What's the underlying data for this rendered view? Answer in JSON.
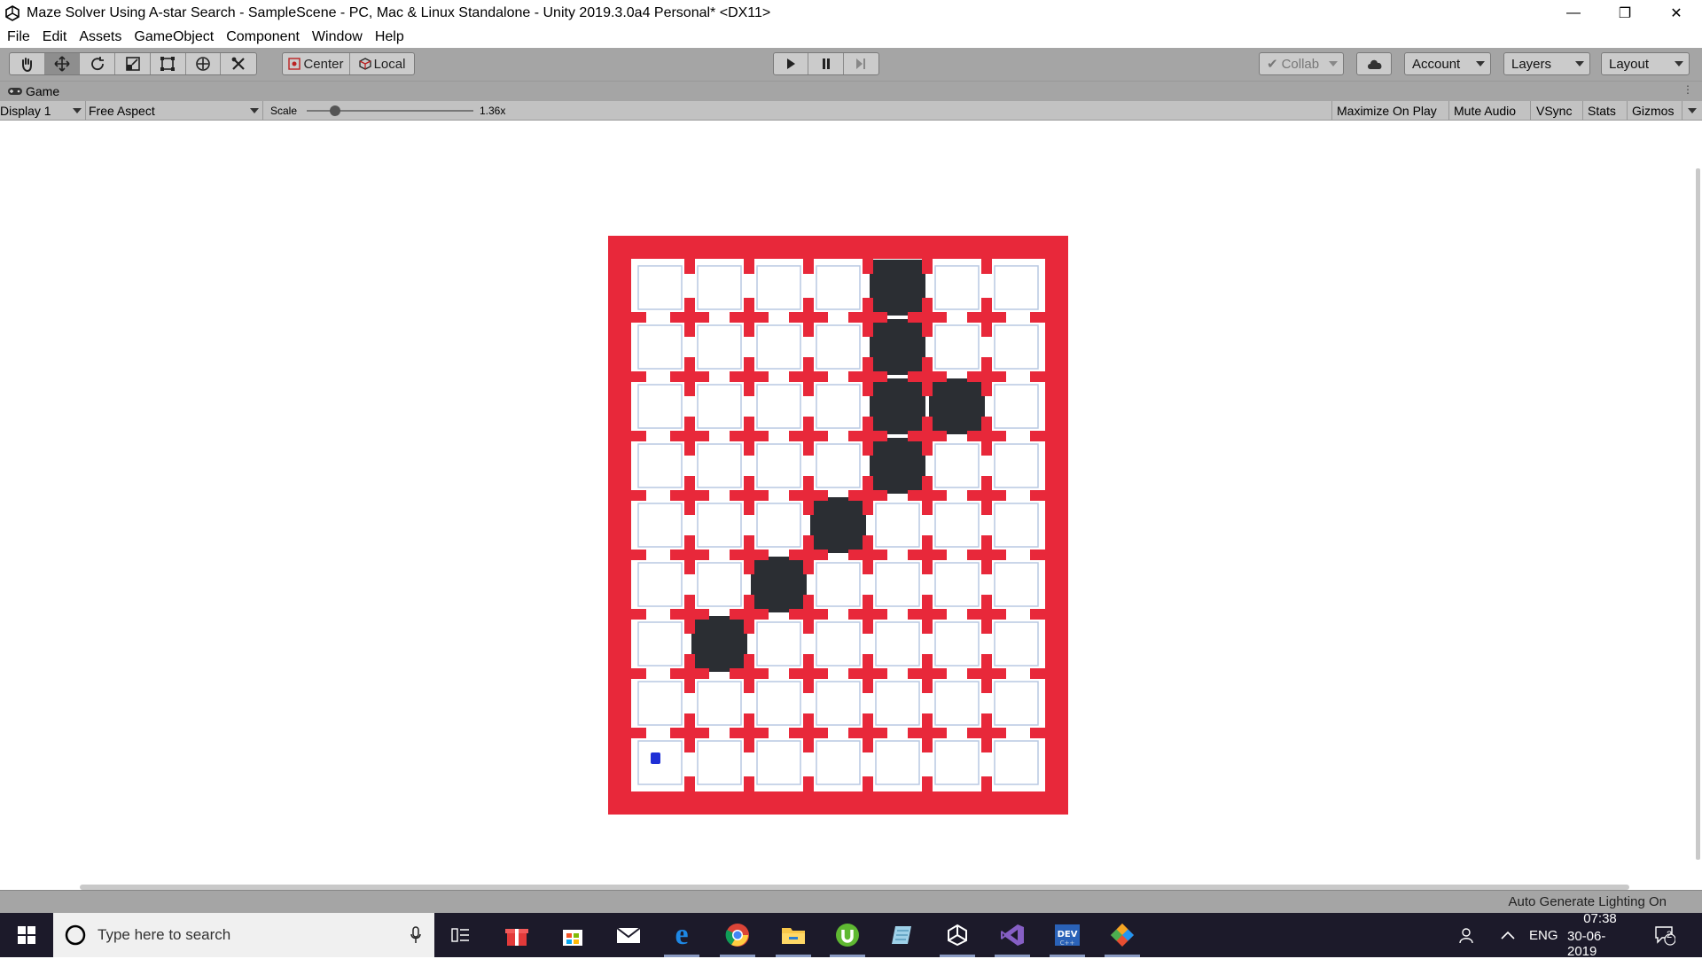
{
  "window": {
    "title": "Maze Solver Using A-star Search - SampleScene - PC, Mac & Linux Standalone - Unity 2019.3.0a4 Personal* <DX11>",
    "minimize": "—",
    "maximize": "❐",
    "close": "✕"
  },
  "menu": [
    "File",
    "Edit",
    "Assets",
    "GameObject",
    "Component",
    "Window",
    "Help"
  ],
  "toolbar": {
    "pivot_label": "Center",
    "space_label": "Local",
    "collab_label": "Collab",
    "account_label": "Account",
    "layers_label": "Layers",
    "layout_label": "Layout"
  },
  "game_view": {
    "tab_label": "Game",
    "display": "Display 1",
    "aspect": "Free Aspect",
    "scale_label": "Scale",
    "scale_value": "1.36x",
    "scale_fraction": 0.17,
    "maximize_on_play": "Maximize On Play",
    "mute_audio": "Mute Audio",
    "vsync": "VSync",
    "stats": "Stats",
    "gizmos": "Gizmos"
  },
  "maze": {
    "columns": 7,
    "rows": 9,
    "path_cells": [
      [
        0,
        4
      ],
      [
        1,
        4
      ],
      [
        2,
        4
      ],
      [
        2,
        5
      ],
      [
        3,
        4
      ],
      [
        4,
        3
      ],
      [
        5,
        2
      ],
      [
        6,
        1
      ]
    ],
    "agent_cell": [
      8,
      0
    ],
    "wall_color": "#e8283a",
    "path_color": "#2b2e33",
    "agent_color": "#1f2fd6"
  },
  "status": {
    "lighting": "Auto Generate Lighting On"
  },
  "taskbar": {
    "search_placeholder": "Type here to search",
    "language": "ENG",
    "time": "07:38",
    "date": "30-06-2019",
    "notification_count": "2",
    "apps": [
      "task-view-icon",
      "gift-icon",
      "store-icon",
      "mail-icon",
      "edge-icon",
      "chrome-icon",
      "file-explorer-icon",
      "utorrent-icon",
      "notepad-icon",
      "unity-icon",
      "visual-studio-icon",
      "dev-cpp-icon",
      "git-icon"
    ]
  }
}
